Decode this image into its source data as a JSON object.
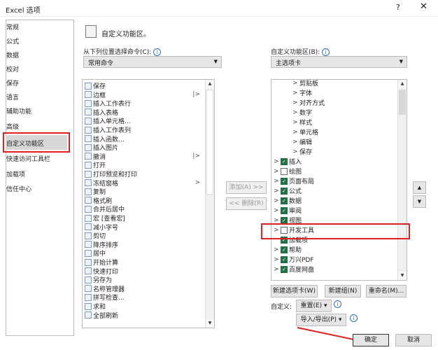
{
  "window": {
    "title": "Excel 选项",
    "help": "?",
    "close": "✕"
  },
  "sidebar": {
    "items": [
      "常规",
      "公式",
      "数据",
      "校对",
      "保存",
      "语言",
      "辅助功能",
      "高级",
      "自定义功能区",
      "快速访问工具栏",
      "加载项",
      "信任中心"
    ],
    "selected": 8
  },
  "header": {
    "title": "自定义功能区。"
  },
  "left": {
    "label": "从下列位置选择命令(C):",
    "select": "常用命令",
    "items": [
      {
        "t": "保存"
      },
      {
        "t": "边框",
        "sub": "|>"
      },
      {
        "t": "插入工作表行"
      },
      {
        "t": "插入表格"
      },
      {
        "t": "插入单元格..."
      },
      {
        "t": "插入工作表列"
      },
      {
        "t": "插入函数..."
      },
      {
        "t": "插入图片"
      },
      {
        "t": "撤消",
        "sub": "|>"
      },
      {
        "t": "打开"
      },
      {
        "t": "打印预览和打印"
      },
      {
        "t": "冻结窗格",
        "sub": ">"
      },
      {
        "t": "复制"
      },
      {
        "t": "格式刷"
      },
      {
        "t": "合并后居中"
      },
      {
        "t": "宏 [查看宏]"
      },
      {
        "t": "减小字号"
      },
      {
        "t": "剪切"
      },
      {
        "t": "降序排序"
      },
      {
        "t": "居中"
      },
      {
        "t": "开始计算"
      },
      {
        "t": "快速打印"
      },
      {
        "t": "另存为"
      },
      {
        "t": "名称管理器"
      },
      {
        "t": "拼写检查..."
      },
      {
        "t": "求和"
      },
      {
        "t": "全部刷新"
      }
    ]
  },
  "middle": {
    "add": "添加(A) >>",
    "remove": "<< 删除(R)"
  },
  "right": {
    "label": "自定义功能区(B):",
    "select": "主选项卡",
    "items": [
      {
        "t": "剪贴板",
        "lvl": 1
      },
      {
        "t": "字体",
        "lvl": 1
      },
      {
        "t": "对齐方式",
        "lvl": 1
      },
      {
        "t": "数字",
        "lvl": 1
      },
      {
        "t": "样式",
        "lvl": 1
      },
      {
        "t": "单元格",
        "lvl": 1
      },
      {
        "t": "编辑",
        "lvl": 1
      },
      {
        "t": "保存",
        "lvl": 1
      },
      {
        "t": "插入",
        "cb": true
      },
      {
        "t": "绘图",
        "cb": false
      },
      {
        "t": "页面布局",
        "cb": true
      },
      {
        "t": "公式",
        "cb": true
      },
      {
        "t": "数据",
        "cb": true
      },
      {
        "t": "审阅",
        "cb": true
      },
      {
        "t": "视图",
        "cb": true
      },
      {
        "t": "开发工具",
        "cb": false
      },
      {
        "t": "加载项",
        "cb": true,
        "nochev": true
      },
      {
        "t": "帮助",
        "cb": true
      },
      {
        "t": "万兴PDF",
        "cb": true
      },
      {
        "t": "百度网盘",
        "cb": true
      }
    ],
    "new_tab": "新建选项卡(W)",
    "new_group": "新建组(N)",
    "rename": "重命名(M)...",
    "customize_label": "自定义:",
    "reset": "重置(E) ▾",
    "import_export": "导入/导出(P) ▾"
  },
  "footer": {
    "ok": "确定",
    "cancel": "取消"
  },
  "colors": {
    "highlight": "#e02020",
    "check": "#217346"
  }
}
